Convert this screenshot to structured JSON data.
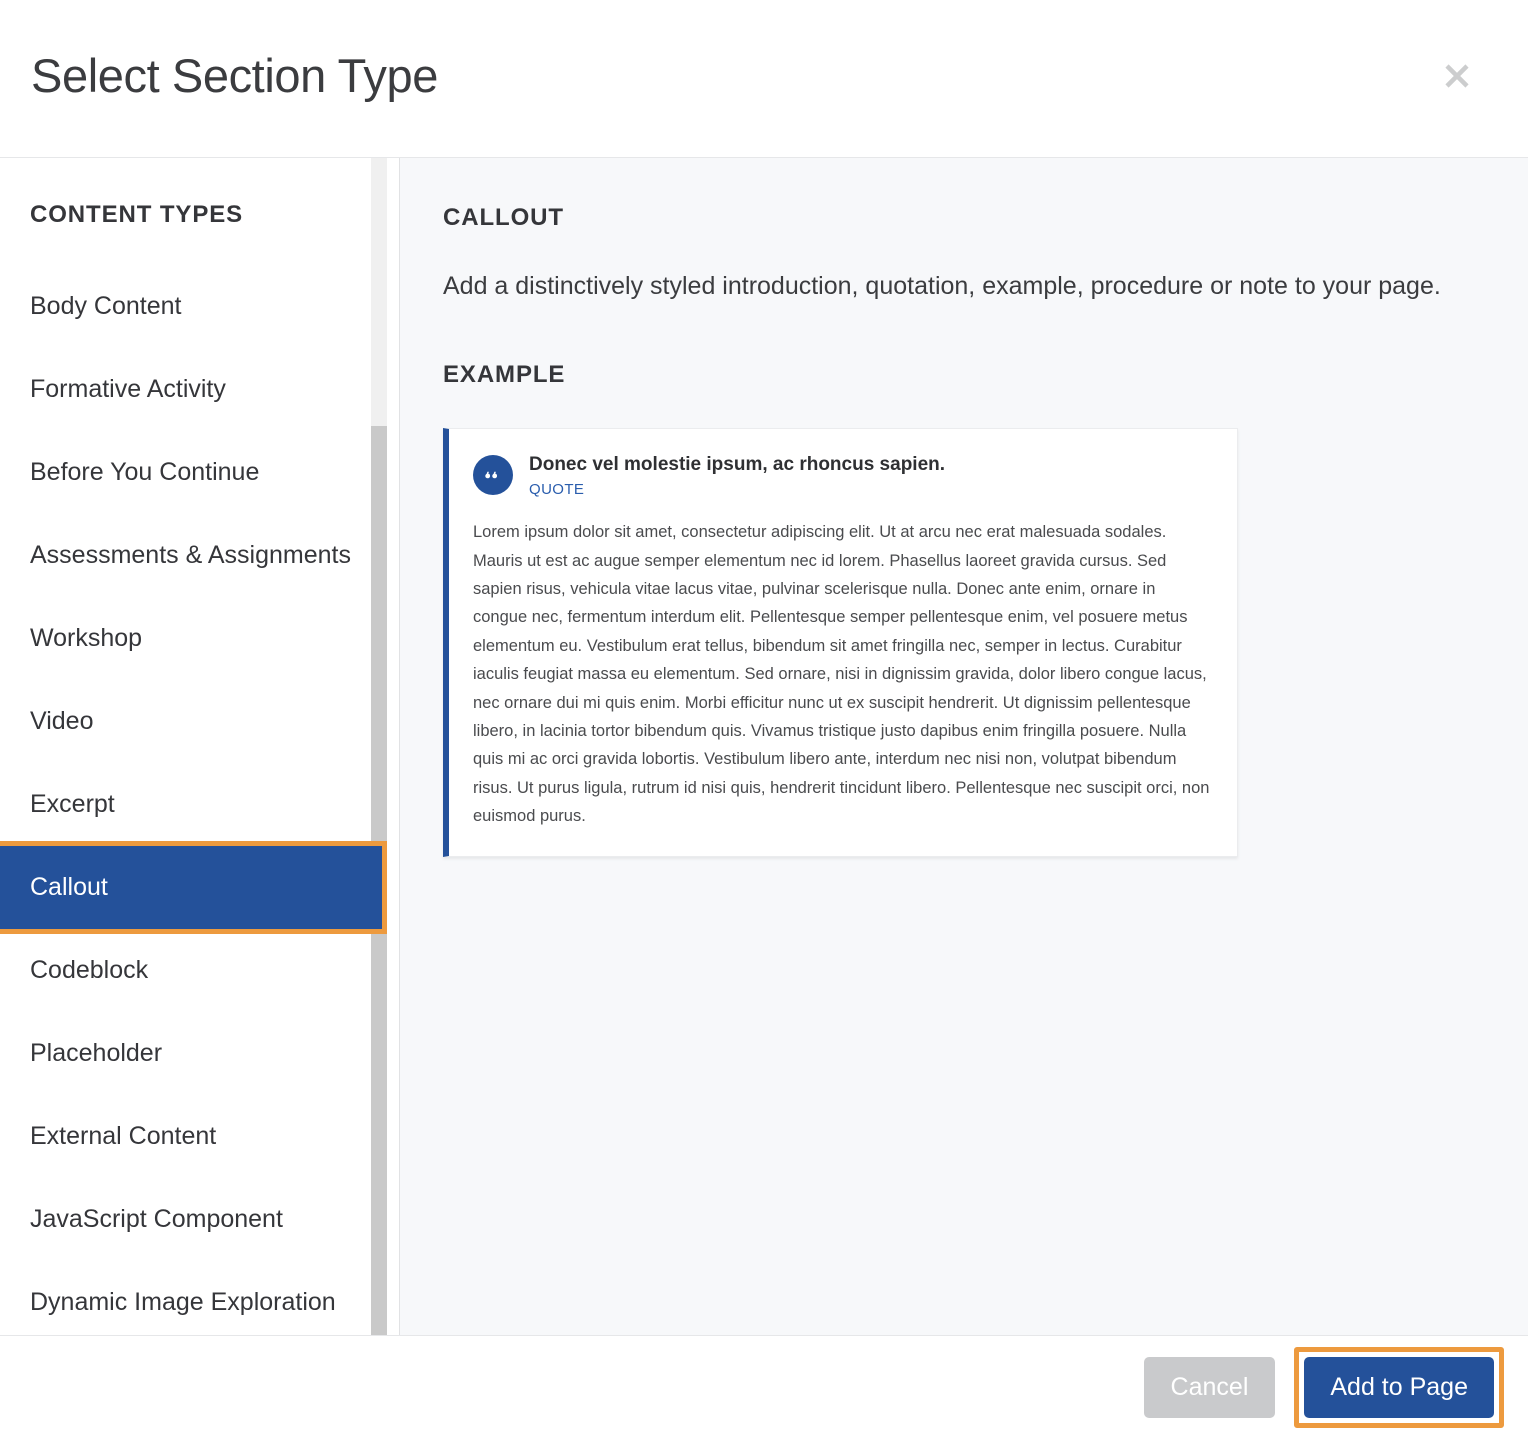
{
  "dialog": {
    "title": "Select Section Type",
    "close_icon": "close-icon"
  },
  "sidebar": {
    "heading": "CONTENT TYPES",
    "selected": "Callout",
    "items": [
      {
        "label": "Body Content"
      },
      {
        "label": "Formative Activity"
      },
      {
        "label": "Before You Continue"
      },
      {
        "label": "Assessments & Assignments"
      },
      {
        "label": "Workshop"
      },
      {
        "label": "Video"
      },
      {
        "label": "Excerpt"
      },
      {
        "label": "Callout"
      },
      {
        "label": "Codeblock"
      },
      {
        "label": "Placeholder"
      },
      {
        "label": "External Content"
      },
      {
        "label": "JavaScript Component"
      },
      {
        "label": "Dynamic Image Exploration"
      }
    ]
  },
  "detail": {
    "heading": "CALLOUT",
    "description": "Add a distinctively styled introduction, quotation, example, procedure or note to your page.",
    "example_heading": "EXAMPLE",
    "example": {
      "badge_icon": "quote-icon",
      "title": "Donec vel molestie ipsum, ac rhoncus sapien.",
      "kicker": "QUOTE",
      "body": "Lorem ipsum dolor sit amet, consectetur adipiscing elit. Ut at arcu nec erat malesuada sodales. Mauris ut est ac augue semper elementum nec id lorem. Phasellus laoreet gravida cursus. Sed sapien risus, vehicula vitae lacus vitae, pulvinar scelerisque nulla. Donec ante enim, ornare in congue nec, fermentum interdum elit. Pellentesque semper pellentesque enim, vel posuere metus elementum eu. Vestibulum erat tellus, bibendum sit amet fringilla nec, semper in lectus. Curabitur iaculis feugiat massa eu elementum. Sed ornare, nisi in dignissim gravida, dolor libero congue lacus, nec ornare dui mi quis enim. Morbi efficitur nunc ut ex suscipit hendrerit. Ut dignissim pellentesque libero, in lacinia tortor bibendum quis. Vivamus tristique justo dapibus enim fringilla posuere. Nulla quis mi ac orci gravida lobortis. Vestibulum libero ante, interdum nec nisi non, volutpat bibendum risus. Ut purus ligula, rutrum id nisi quis, hendrerit tincidunt libero. Pellentesque nec suscipit orci, non euismod purus."
    }
  },
  "footer": {
    "cancel_label": "Cancel",
    "submit_label": "Add to Page"
  },
  "colors": {
    "accent_blue": "#24519a",
    "highlight_orange": "#ed9a3e",
    "panel_bg": "#f7f8fa",
    "cancel_gray": "#c9cacc",
    "scrollbar_thumb": "#c9c9c9"
  }
}
